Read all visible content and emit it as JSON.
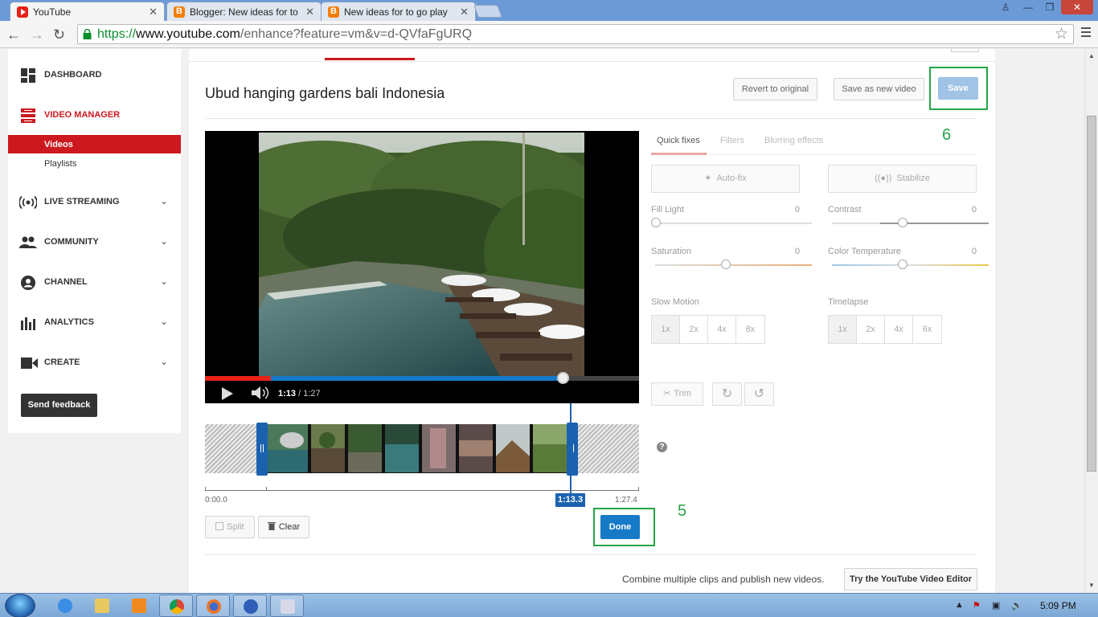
{
  "browser": {
    "tabs": [
      {
        "label": "YouTube",
        "favicon": "youtube-icon"
      },
      {
        "label": "Blogger: New ideas for to",
        "favicon": "blogger-icon"
      },
      {
        "label": "New ideas for to go play",
        "favicon": "blogger-icon"
      }
    ],
    "url": {
      "scheme": "https://",
      "host": "www.youtube.com",
      "path": "/enhance?feature=vm&v=d-QVfaFgURQ"
    }
  },
  "sidebar": {
    "items": [
      {
        "label": "DASHBOARD",
        "icon": "dashboard-icon"
      },
      {
        "label": "VIDEO MANAGER",
        "icon": "video-manager-icon"
      },
      {
        "label": "LIVE STREAMING",
        "icon": "live-streaming-icon"
      },
      {
        "label": "COMMUNITY",
        "icon": "community-icon"
      },
      {
        "label": "CHANNEL",
        "icon": "channel-icon"
      },
      {
        "label": "ANALYTICS",
        "icon": "analytics-icon"
      },
      {
        "label": "CREATE",
        "icon": "create-icon"
      }
    ],
    "subitems": [
      "Videos",
      "Playlists"
    ],
    "feedback": "Send feedback"
  },
  "editor": {
    "title": "Ubud hanging gardens bali Indonesia",
    "revert": "Revert to original",
    "save_new": "Save as new video",
    "save": "Save",
    "annotation_save": "6",
    "annotation_done": "5",
    "player": {
      "current": "1:13",
      "separator": " / ",
      "duration": "1:27",
      "progress_fraction": 0.84
    },
    "trim": {
      "start": "0:00.0",
      "end": "1:27.4",
      "playhead": "1:13.3"
    },
    "split": "Split",
    "clear": "Clear",
    "done": "Done",
    "tabs": [
      "Quick fixes",
      "Filters",
      "Blurring effects"
    ],
    "autofix": "Auto-fix",
    "stabilize": "Stabilize",
    "sliders": [
      {
        "label": "Fill Light",
        "value": "0"
      },
      {
        "label": "Contrast",
        "value": "0"
      },
      {
        "label": "Saturation",
        "value": "0"
      },
      {
        "label": "Color Temperature",
        "value": "0"
      }
    ],
    "slow_motion": {
      "label": "Slow Motion",
      "options": [
        "1x",
        "2x",
        "4x",
        "8x"
      ]
    },
    "timelapse": {
      "label": "Timelapse",
      "options": [
        "1x",
        "2x",
        "4x",
        "6x"
      ]
    },
    "trim_btn": "Trim",
    "help": "?",
    "combine_text": "Combine multiple clips and publish new videos.",
    "editor_btn": "Try the YouTube Video Editor"
  },
  "taskbar": {
    "clock": "5:09 PM"
  },
  "colors": {
    "brand_red": "#cc181e",
    "accent_blue": "#167ac6",
    "highlight_green": "#26a548"
  }
}
